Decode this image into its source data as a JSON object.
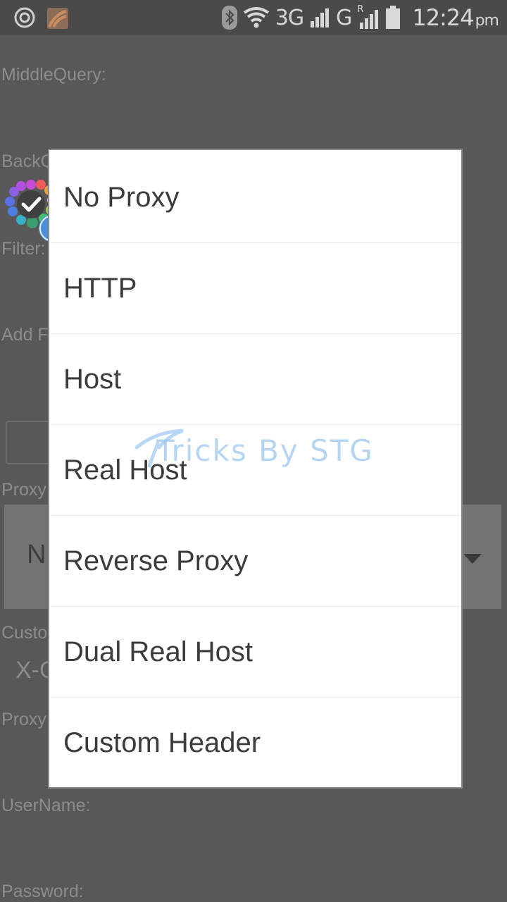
{
  "status_bar": {
    "network_1": "3G",
    "network_2": "G",
    "roaming": "R",
    "time": "12:24",
    "ampm": "pm",
    "icons": [
      "target-icon",
      "app-notification-icon",
      "bluetooth-icon",
      "wifi-icon",
      "signal-icon",
      "signal-icon",
      "battery-icon"
    ]
  },
  "background_form": {
    "middle_query_label": "MiddleQuery:",
    "back_query_label": "BackQ",
    "filter_label": "Filter:",
    "add_label": "Add F",
    "proxy_type_label": "Proxy",
    "spinner_value": "N",
    "custom_label": "Custo",
    "custom_value": "X-O",
    "proxy_label": "Proxy",
    "username_label": "UserName:",
    "password_label": "Password:"
  },
  "dialog": {
    "options": [
      "No Proxy",
      "HTTP",
      "Host",
      "Real Host",
      "Reverse Proxy",
      "Dual Real Host",
      "Custom Header"
    ]
  },
  "watermark": {
    "text": "Tricks By STG"
  },
  "colors": {
    "overlay_bg": "#585858",
    "dialog_bg": "#ffffff",
    "option_text": "#3c3c3c",
    "watermark": "#9ec8f0"
  }
}
